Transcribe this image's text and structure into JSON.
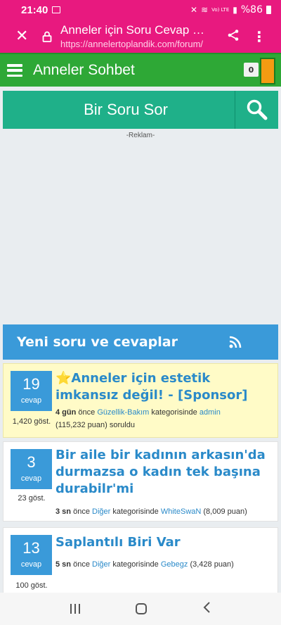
{
  "status": {
    "time": "21:40",
    "battery": "%86",
    "network": "Vo) LTE"
  },
  "browser": {
    "title": "Anneler için Soru Cevap Platformu",
    "url": "https://annelertoplandik.com/forum/"
  },
  "header": {
    "site_title": "Anneler Sohbet",
    "notification_count": "0"
  },
  "ask": {
    "label": "Bir Soru Sor",
    "ad_label": "-Reklam-"
  },
  "section": {
    "title": "Yeni soru ve cevaplar"
  },
  "questions": [
    {
      "answers": "19",
      "answers_label": "cevap",
      "views": "1,420 göst.",
      "title": "⭐Anneler için estetik imkansız değil! - [Sponsor]",
      "time": "4 gün",
      "before": "önce",
      "category": "Güzellik-Bakım",
      "cat_suffix": "kategorisinde",
      "user": "admin",
      "points": "(115,232 puan)",
      "suffix": "soruldu"
    },
    {
      "answers": "3",
      "answers_label": "cevap",
      "views": "23 göst.",
      "title": "Bir aile bir kadının arkasın'da durmazsa o kadın tek başına durabilr'mi",
      "time": "3 sn",
      "before": "önce",
      "category": "Diğer",
      "cat_suffix": "kategorisinde",
      "user": "WhiteSwaN",
      "points": "(8,009 puan)",
      "suffix": ""
    },
    {
      "answers": "13",
      "answers_label": "cevap",
      "views": "100 göst.",
      "title": "Saplantılı Biri Var",
      "time": "5 sn",
      "before": "önce",
      "category": "Diğer",
      "cat_suffix": "kategorisinde",
      "user": "Gebegz",
      "points": "(3,428 puan)",
      "suffix": ""
    }
  ],
  "colors": {
    "browser_bar": "#e8197f",
    "site_header": "#2ea836",
    "ask_bar": "#1fb089",
    "section": "#3a9ad9",
    "featured_bg": "#fffbc7"
  }
}
